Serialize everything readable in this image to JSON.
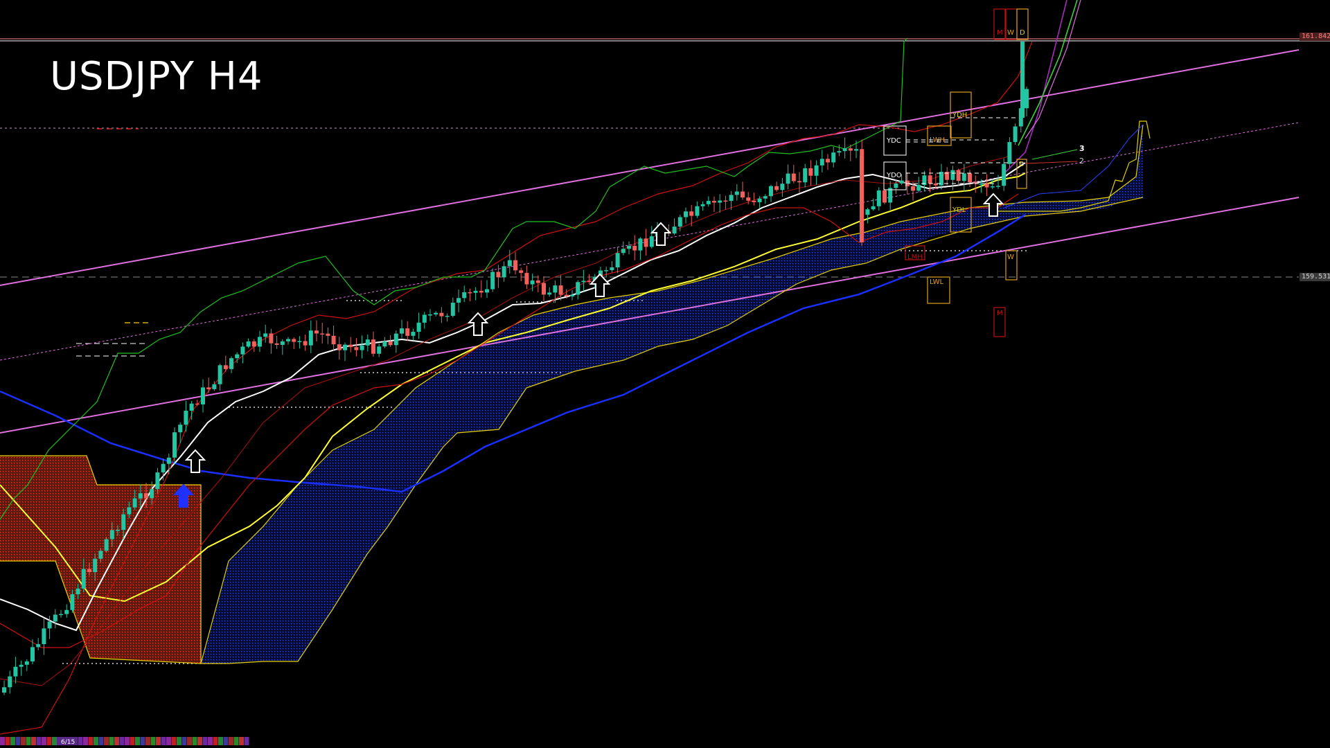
{
  "title": "USDJPY H4",
  "price_labels": {
    "middle_right": "159.531",
    "top_right": "161.842"
  },
  "bottom_bar_label": "6/15",
  "level_boxes": {
    "ydh": "YDH",
    "ydc": "YDC",
    "ydo": "YDO",
    "ydl": "YDL",
    "lwh": "LWH",
    "lwl": "LWL",
    "lmh": "LMH",
    "m_top": "M",
    "w_top": "W",
    "d_top": "D",
    "d_mid": "D",
    "w_bottom": "W",
    "m_bottom": "M"
  },
  "pivot_labels": [
    "3",
    "2"
  ],
  "colors": {
    "bull": "#24c5a3",
    "bear": "#f0605c",
    "channel": "#e070e0",
    "ma_white": "#ffffff",
    "ma_yellow": "#ffff33",
    "ma_blue": "#1a2fff",
    "cloud_bull": "#2040ff",
    "cloud_bear": "#ff4a2a",
    "cloud_edge": "#e6d200",
    "bollinger": "#d01010",
    "rsi_line": "#20c020",
    "box_orange": "#e0a020",
    "box_red": "#c01010"
  },
  "chart_data": {
    "type": "candlestick",
    "title": "USDJPY H4",
    "y_price_labels": [
      159.531,
      161.842
    ],
    "close_path": [
      147.6,
      147.9,
      148.3,
      148.7,
      149.2,
      149.6,
      150.1,
      150.4,
      150.9,
      151.3,
      151.6,
      151.8,
      152.0,
      152.2,
      152.3,
      152.5,
      152.6,
      152.8,
      153.1,
      153.4,
      153.6,
      153.9,
      154.2,
      154.5,
      154.8,
      155.0,
      155.3,
      155.6,
      155.8,
      156.0,
      156.1,
      156.3,
      156.5,
      156.8,
      157.0,
      157.2,
      157.4,
      157.6,
      157.8,
      158.0,
      158.2,
      158.4,
      158.5,
      158.6,
      158.7,
      158.8,
      159.4,
      159.1,
      159.0,
      159.3,
      159.1,
      159.2,
      159.0,
      159.2,
      159.8,
      160.4,
      161.2,
      161.9
    ],
    "indicators": [
      "Ichimoku cloud",
      "Moving averages",
      "Bollinger bands",
      "Price channel",
      "Daily/Weekly/Monthly levels"
    ]
  }
}
